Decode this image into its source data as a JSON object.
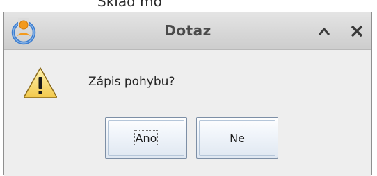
{
  "background": {
    "partial_text": "Sklad mo"
  },
  "dialog": {
    "title": "Dotaz",
    "message": "Zápis pohybu?",
    "buttons": {
      "yes": {
        "mnemonic": "A",
        "rest": "no"
      },
      "no": {
        "mnemonic": "N",
        "rest": "e"
      }
    },
    "icons": {
      "app": "app-logo-icon",
      "maximize": "chevron-up-icon",
      "close": "close-icon",
      "message": "warning-icon"
    }
  }
}
